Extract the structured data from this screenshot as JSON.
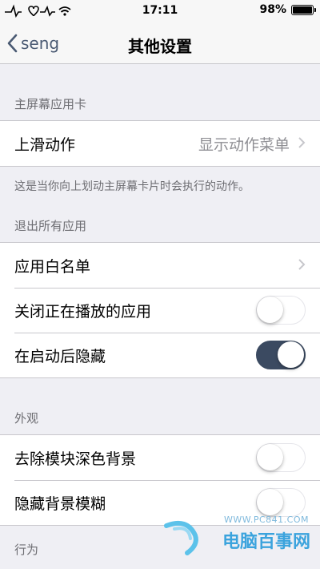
{
  "status_bar": {
    "time": "17:11",
    "battery": "98%",
    "battery_level": 0.98
  },
  "nav": {
    "back_label": "seng",
    "title": "其他设置"
  },
  "sections": {
    "home_card": {
      "header": "主屏幕应用卡",
      "swipe_label": "上滑动作",
      "swipe_value": "显示动作菜单",
      "footer": "这是当你向上划动主屏幕卡片时会执行的动作。"
    },
    "quit_all": {
      "header": "退出所有应用",
      "whitelist_label": "应用白名单",
      "close_playing_label": "关闭正在播放的应用",
      "close_playing_on": false,
      "hide_after_launch_label": "在启动后隐藏",
      "hide_after_launch_on": true
    },
    "appearance": {
      "header": "外观",
      "remove_dark_bg_label": "去除模块深色背景",
      "remove_dark_bg_on": false,
      "hide_blur_label": "隐藏背景模糊",
      "hide_blur_on": false
    },
    "behavior": {
      "header": "行为"
    }
  },
  "watermark": {
    "url": "WWW.PC841.COM",
    "text": "电脑百事网"
  },
  "colors": {
    "accent": "#3b4a61",
    "background": "#efeff4",
    "watermark": "#3ba3dd"
  }
}
